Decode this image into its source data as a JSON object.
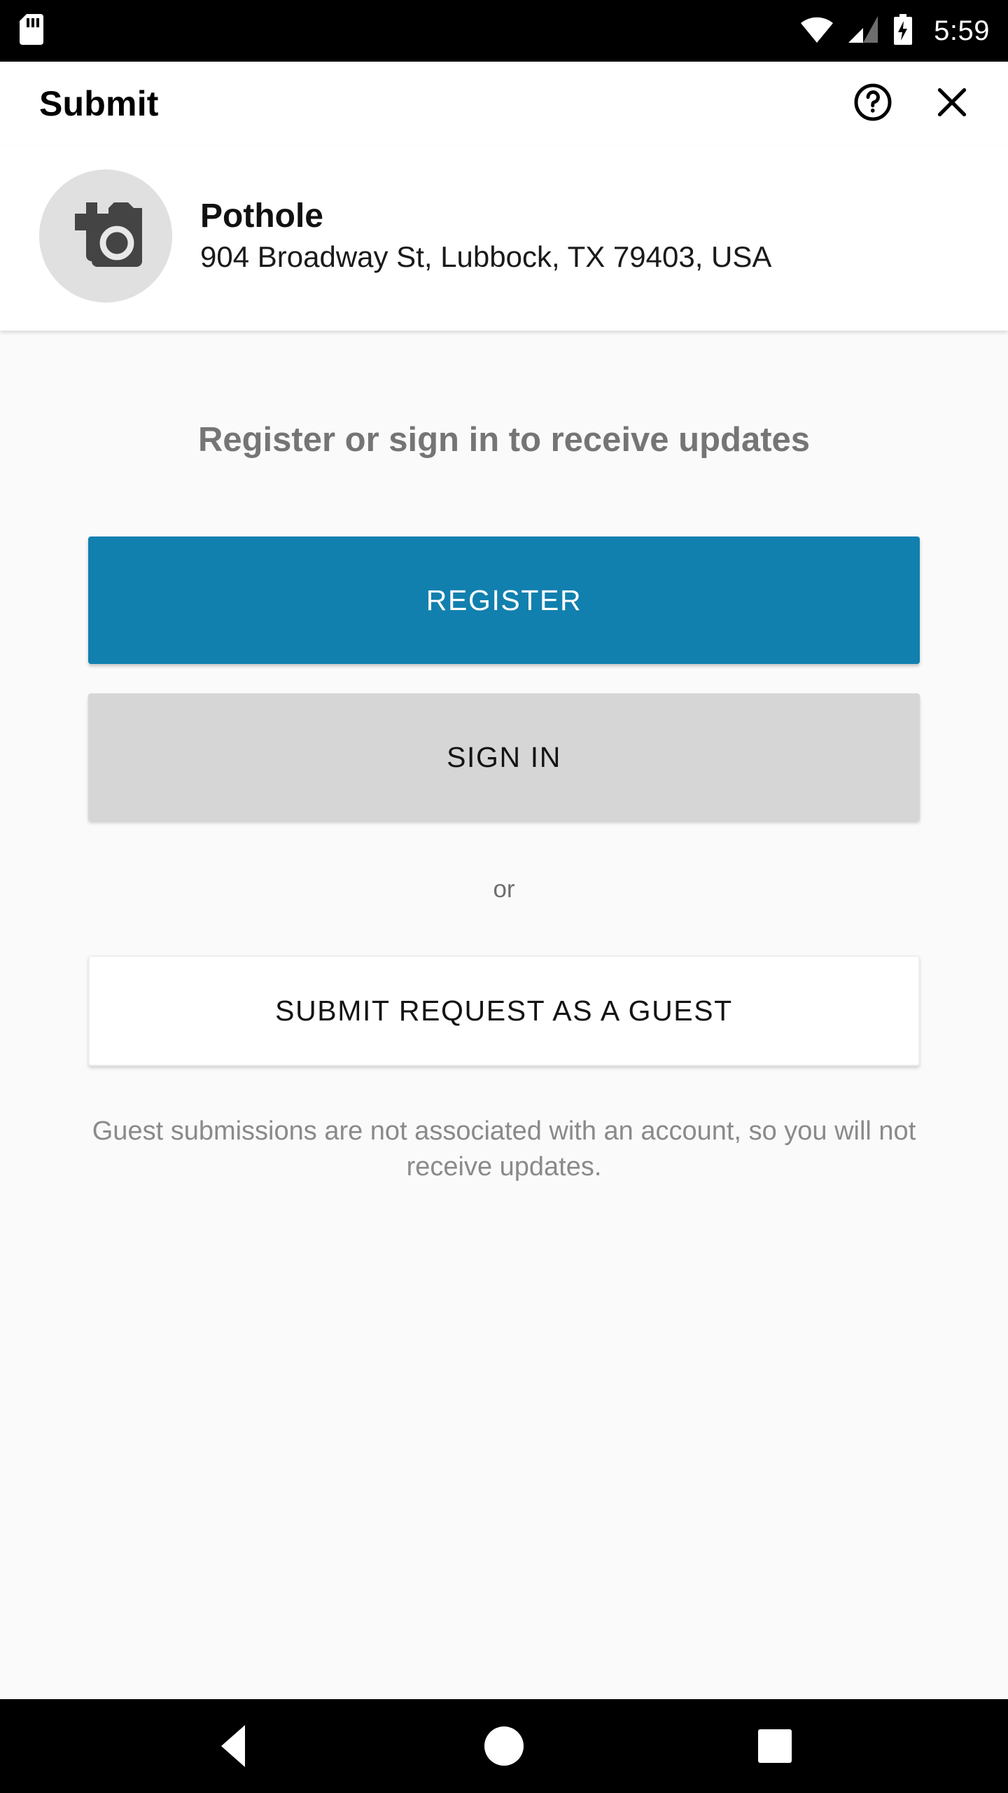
{
  "status_bar": {
    "icons": [
      "sd-card-icon",
      "wifi-icon",
      "cellular-signal-icon",
      "battery-charging-icon"
    ],
    "time": "5:59"
  },
  "app_bar": {
    "title": "Submit",
    "help_icon": "help-circle-icon",
    "close_icon": "close-icon"
  },
  "request": {
    "photo_icon": "add-photo-icon",
    "title": "Pothole",
    "address": "904 Broadway St, Lubbock, TX 79403, USA"
  },
  "main": {
    "heading": "Register or sign in to receive updates",
    "register_label": "REGISTER",
    "signin_label": "SIGN IN",
    "or_label": "or",
    "guest_label": "SUBMIT REQUEST AS A GUEST",
    "disclaimer": "Guest submissions are not associated with an account, so you will not receive updates."
  },
  "nav_bar": {
    "back": "back-button",
    "home": "home-button",
    "recents": "recents-button"
  },
  "colors": {
    "accent": "#1180ae",
    "secondary_button": "#d6d6d6",
    "heading_text": "#757575",
    "content_background": "#fafafa",
    "avatar_background": "#e0e0e0"
  }
}
